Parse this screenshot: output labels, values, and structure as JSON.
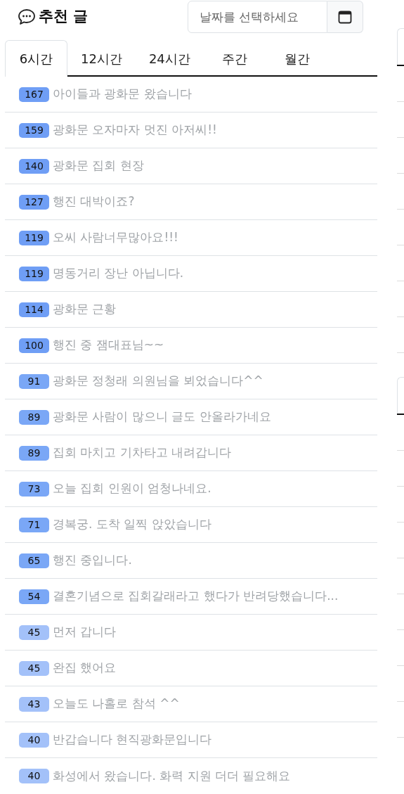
{
  "header": {
    "title": "추천 글",
    "date_picker": {
      "placeholder": "날짜를 선택하세요"
    }
  },
  "tabs": [
    {
      "label": "6시간",
      "selected": true
    },
    {
      "label": "12시간",
      "selected": false
    },
    {
      "label": "24시간",
      "selected": false
    },
    {
      "label": "주간",
      "selected": false
    },
    {
      "label": "월간",
      "selected": false
    }
  ],
  "posts": [
    {
      "count": "167",
      "title": "아이들과 광화문 왔습니다",
      "color": "#6f9ef5"
    },
    {
      "count": "159",
      "title": "광화문 오자마자 멋진 아저씨!!",
      "color": "#6f9ef5"
    },
    {
      "count": "140",
      "title": "광화문 집회 현장",
      "color": "#6f9ef5"
    },
    {
      "count": "127",
      "title": "행진 대박이죠?",
      "color": "#6f9ef5"
    },
    {
      "count": "119",
      "title": "오씨 사람너무많아요!!!",
      "color": "#6f9ef5"
    },
    {
      "count": "119",
      "title": "명동거리 장난 아닙니다.",
      "color": "#6f9ef5"
    },
    {
      "count": "114",
      "title": "광화문 근황",
      "color": "#6f9ef5"
    },
    {
      "count": "100",
      "title": "행진 중 잼대표님~~",
      "color": "#6f9ef5"
    },
    {
      "count": "91",
      "title": "광화문 정청래 의원님을 뵈었습니다^^",
      "color": "#7aa7f6"
    },
    {
      "count": "89",
      "title": "광화문 사람이 많으니 글도 안올라가네요",
      "color": "#7aa7f6"
    },
    {
      "count": "89",
      "title": "집회 마치고 기차타고 내려갑니다",
      "color": "#7aa7f6"
    },
    {
      "count": "73",
      "title": "오늘 집회 인원이 엄청나네요.",
      "color": "#7aa7f6"
    },
    {
      "count": "71",
      "title": "경복궁. 도착 일찍 앉았습니다",
      "color": "#7aa7f6"
    },
    {
      "count": "65",
      "title": "행진 중입니다.",
      "color": "#7aa7f6"
    },
    {
      "count": "54",
      "title": "결혼기념으로 집회갈래라고 했다가 반려당했습니다...",
      "color": "#7aa7f6"
    },
    {
      "count": "45",
      "title": "먼저 갑니다",
      "color": "#a3c1f9"
    },
    {
      "count": "45",
      "title": "완집 했어요",
      "color": "#a3c1f9"
    },
    {
      "count": "43",
      "title": "오늘도 나홀로 참석 ^^",
      "color": "#a3c1f9"
    },
    {
      "count": "40",
      "title": "반갑습니다 현직광화문입니다",
      "color": "#a3c1f9"
    },
    {
      "count": "40",
      "title": "화성에서 왔습니다. 화력 지원 더더 필요해요",
      "color": "#a3c1f9"
    }
  ]
}
